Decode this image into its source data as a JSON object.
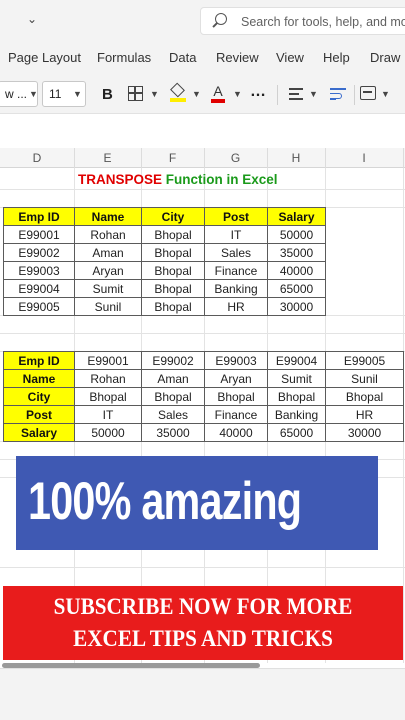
{
  "search": {
    "placeholder": "Search for tools, help, and mo"
  },
  "ribbon_tabs": [
    "Page Layout",
    "Formulas",
    "Data",
    "Review",
    "View",
    "Help",
    "Draw"
  ],
  "toolbar": {
    "font_name": "w ...",
    "font_size": "11",
    "bold_label": "B",
    "more_label": "…"
  },
  "columns": [
    "D",
    "E",
    "F",
    "G",
    "H",
    "I"
  ],
  "sheet_title": {
    "part1": "TRANSPOSE",
    "part2": "Function in Excel"
  },
  "original_table": {
    "headers": [
      "Emp ID",
      "Name",
      "City",
      "Post",
      "Salary"
    ],
    "rows": [
      [
        "E99001",
        "Rohan",
        "Bhopal",
        "IT",
        "50000"
      ],
      [
        "E99002",
        "Aman",
        "Bhopal",
        "Sales",
        "35000"
      ],
      [
        "E99003",
        "Aryan",
        "Bhopal",
        "Finance",
        "40000"
      ],
      [
        "E99004",
        "Sumit",
        "Bhopal",
        "Banking",
        "65000"
      ],
      [
        "E99005",
        "Sunil",
        "Bhopal",
        "HR",
        "30000"
      ]
    ]
  },
  "transposed_table": {
    "rows": [
      [
        "Emp ID",
        "E99001",
        "E99002",
        "E99003",
        "E99004",
        "E99005"
      ],
      [
        "Name",
        "Rohan",
        "Aman",
        "Aryan",
        "Sumit",
        "Sunil"
      ],
      [
        "City",
        "Bhopal",
        "Bhopal",
        "Bhopal",
        "Bhopal",
        "Bhopal"
      ],
      [
        "Post",
        "IT",
        "Sales",
        "Finance",
        "Banking",
        "HR"
      ],
      [
        "Salary",
        "50000",
        "35000",
        "40000",
        "65000",
        "30000"
      ]
    ]
  },
  "banner_text": "100% amazing",
  "subscribe": {
    "line1": "SUBSCRIBE NOW FOR MORE",
    "line2": "EXCEL TIPS AND TRICKS"
  },
  "colors": {
    "header_yellow": "#ffff00",
    "banner_blue": "#3f59b3",
    "subscribe_red": "#e81c1c",
    "title_red": "#e00000",
    "title_green": "#1a9a1a"
  }
}
